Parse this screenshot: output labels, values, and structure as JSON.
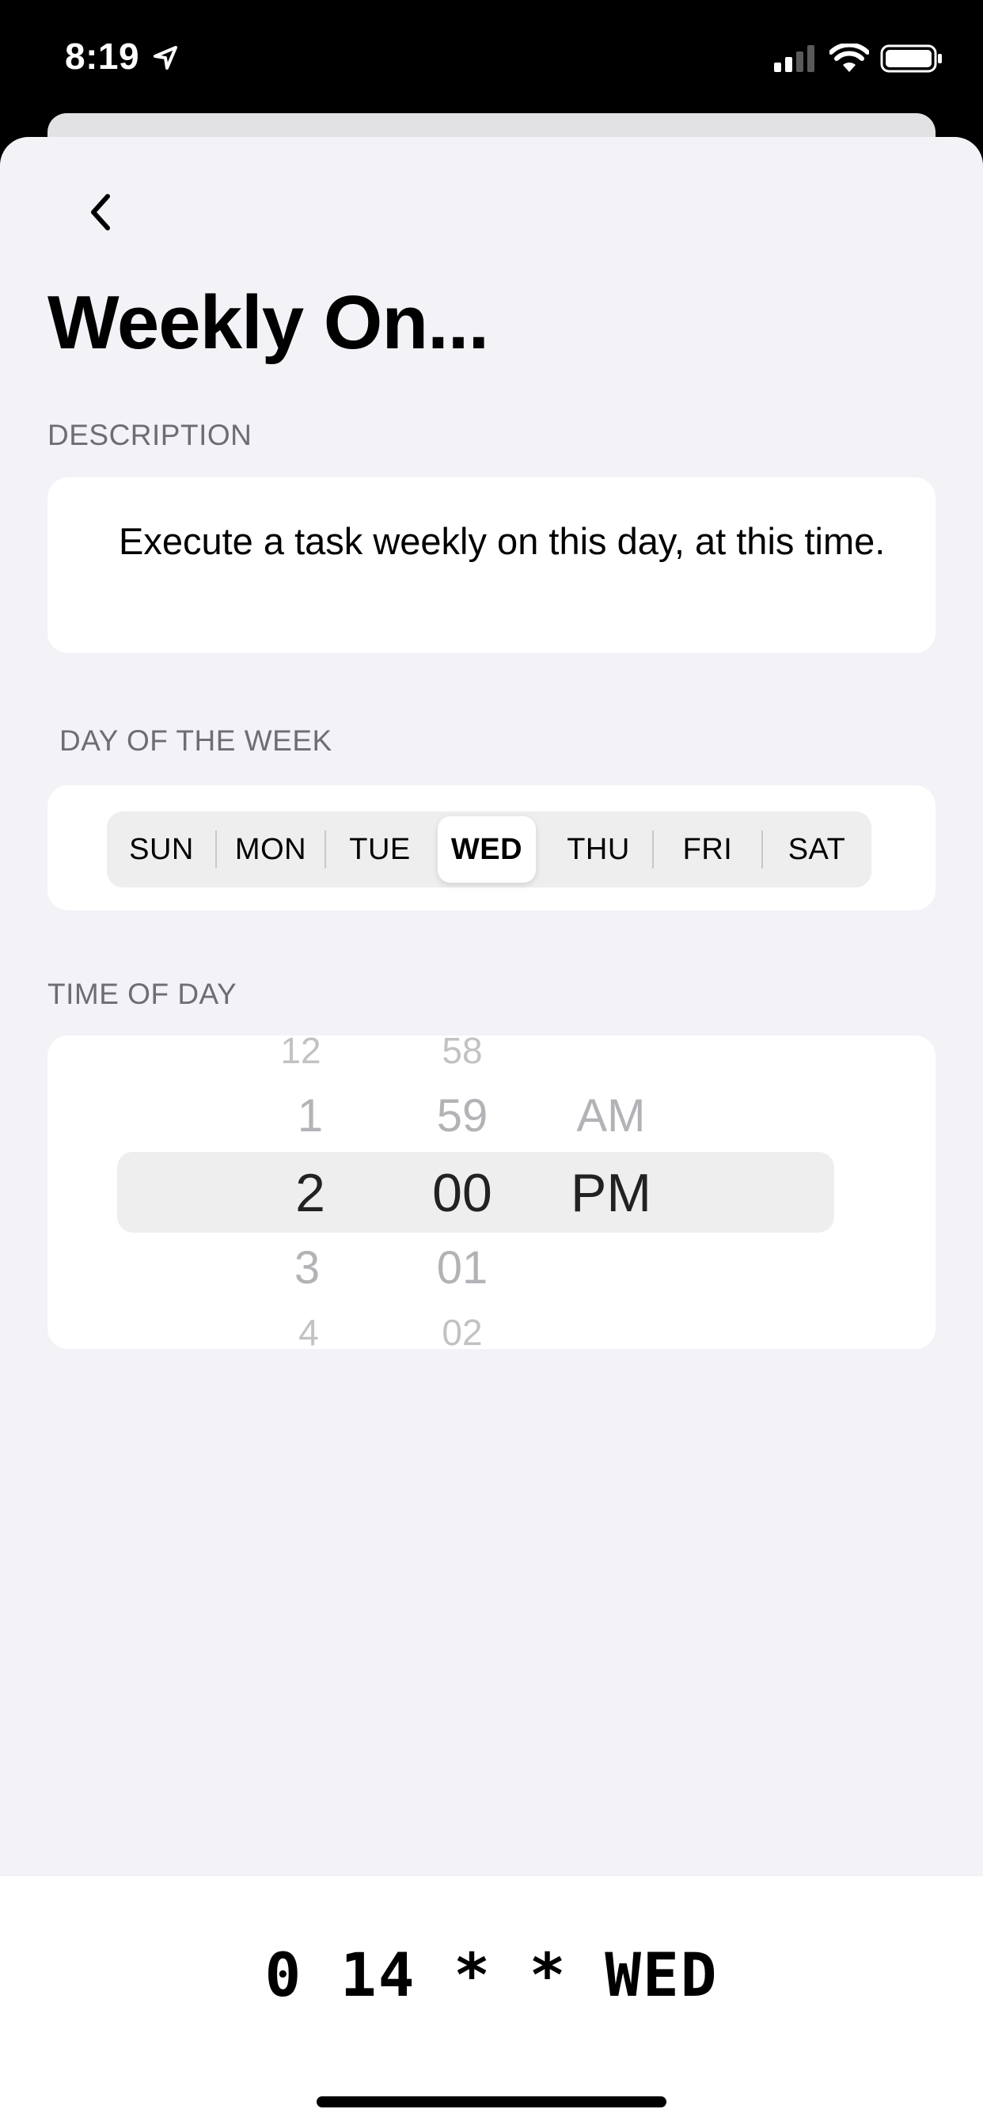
{
  "status_bar": {
    "time": "8:19"
  },
  "header": {
    "title": "Weekly On..."
  },
  "description": {
    "section_label": "DESCRIPTION",
    "text": "Execute a task weekly on this day, at this time."
  },
  "day_of_week": {
    "section_label": "DAY OF THE WEEK",
    "days": [
      "SUN",
      "MON",
      "TUE",
      "WED",
      "THU",
      "FRI",
      "SAT"
    ],
    "selected": "WED"
  },
  "time_of_day": {
    "section_label": "TIME OF DAY",
    "hours": [
      "12",
      "1",
      "2",
      "3",
      "4"
    ],
    "minutes": [
      "58",
      "59",
      "00",
      "01",
      "02"
    ],
    "periods": [
      "AM",
      "PM"
    ],
    "selected": {
      "hour": "2",
      "minute": "00",
      "period": "PM"
    }
  },
  "cron": {
    "expression": "0 14 * * WED"
  }
}
